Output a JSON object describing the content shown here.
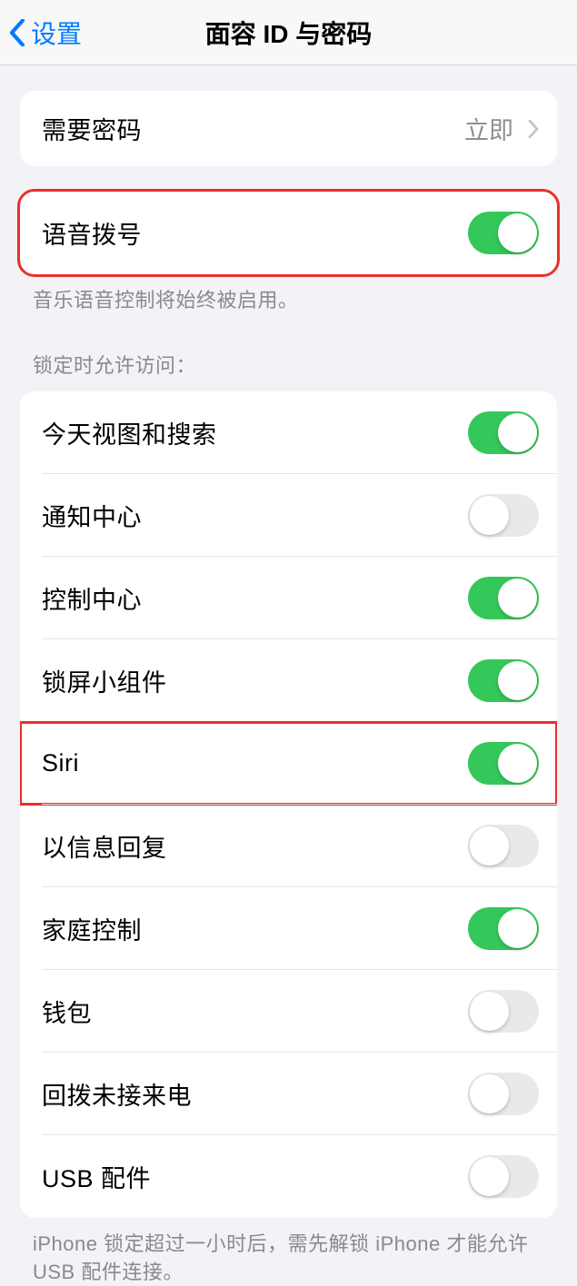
{
  "header": {
    "back_label": "设置",
    "title": "面容 ID 与密码"
  },
  "passcode_row": {
    "label": "需要密码",
    "value": "立即"
  },
  "voice_dial": {
    "label": "语音拨号",
    "on": true,
    "footer": "音乐语音控制将始终被启用。"
  },
  "lock_section": {
    "header": "锁定时允许访问：",
    "items": [
      {
        "label": "今天视图和搜索",
        "on": true,
        "highlight": false
      },
      {
        "label": "通知中心",
        "on": false,
        "highlight": false
      },
      {
        "label": "控制中心",
        "on": true,
        "highlight": false
      },
      {
        "label": "锁屏小组件",
        "on": true,
        "highlight": false
      },
      {
        "label": "Siri",
        "on": true,
        "highlight": true
      },
      {
        "label": "以信息回复",
        "on": false,
        "highlight": false
      },
      {
        "label": "家庭控制",
        "on": true,
        "highlight": false
      },
      {
        "label": "钱包",
        "on": false,
        "highlight": false
      },
      {
        "label": "回拨未接来电",
        "on": false,
        "highlight": false
      },
      {
        "label": "USB 配件",
        "on": false,
        "highlight": false
      }
    ],
    "footer": "iPhone 锁定超过一小时后，需先解锁 iPhone 才能允许 USB 配件连接。"
  }
}
